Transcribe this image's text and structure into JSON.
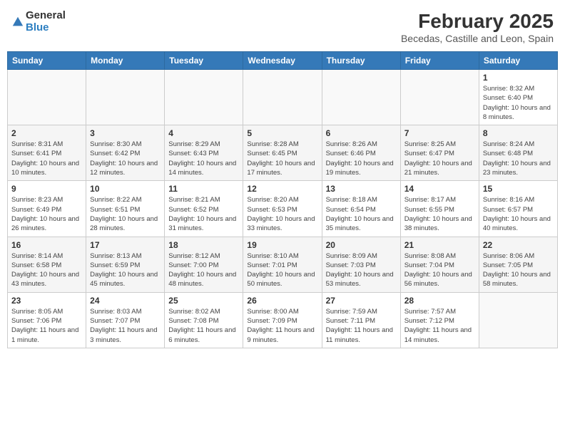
{
  "header": {
    "logo_general": "General",
    "logo_blue": "Blue",
    "title": "February 2025",
    "subtitle": "Becedas, Castille and Leon, Spain"
  },
  "days_of_week": [
    "Sunday",
    "Monday",
    "Tuesday",
    "Wednesday",
    "Thursday",
    "Friday",
    "Saturday"
  ],
  "weeks": [
    [
      {
        "day": "",
        "info": ""
      },
      {
        "day": "",
        "info": ""
      },
      {
        "day": "",
        "info": ""
      },
      {
        "day": "",
        "info": ""
      },
      {
        "day": "",
        "info": ""
      },
      {
        "day": "",
        "info": ""
      },
      {
        "day": "1",
        "info": "Sunrise: 8:32 AM\nSunset: 6:40 PM\nDaylight: 10 hours and 8 minutes."
      }
    ],
    [
      {
        "day": "2",
        "info": "Sunrise: 8:31 AM\nSunset: 6:41 PM\nDaylight: 10 hours and 10 minutes."
      },
      {
        "day": "3",
        "info": "Sunrise: 8:30 AM\nSunset: 6:42 PM\nDaylight: 10 hours and 12 minutes."
      },
      {
        "day": "4",
        "info": "Sunrise: 8:29 AM\nSunset: 6:43 PM\nDaylight: 10 hours and 14 minutes."
      },
      {
        "day": "5",
        "info": "Sunrise: 8:28 AM\nSunset: 6:45 PM\nDaylight: 10 hours and 17 minutes."
      },
      {
        "day": "6",
        "info": "Sunrise: 8:26 AM\nSunset: 6:46 PM\nDaylight: 10 hours and 19 minutes."
      },
      {
        "day": "7",
        "info": "Sunrise: 8:25 AM\nSunset: 6:47 PM\nDaylight: 10 hours and 21 minutes."
      },
      {
        "day": "8",
        "info": "Sunrise: 8:24 AM\nSunset: 6:48 PM\nDaylight: 10 hours and 23 minutes."
      }
    ],
    [
      {
        "day": "9",
        "info": "Sunrise: 8:23 AM\nSunset: 6:49 PM\nDaylight: 10 hours and 26 minutes."
      },
      {
        "day": "10",
        "info": "Sunrise: 8:22 AM\nSunset: 6:51 PM\nDaylight: 10 hours and 28 minutes."
      },
      {
        "day": "11",
        "info": "Sunrise: 8:21 AM\nSunset: 6:52 PM\nDaylight: 10 hours and 31 minutes."
      },
      {
        "day": "12",
        "info": "Sunrise: 8:20 AM\nSunset: 6:53 PM\nDaylight: 10 hours and 33 minutes."
      },
      {
        "day": "13",
        "info": "Sunrise: 8:18 AM\nSunset: 6:54 PM\nDaylight: 10 hours and 35 minutes."
      },
      {
        "day": "14",
        "info": "Sunrise: 8:17 AM\nSunset: 6:55 PM\nDaylight: 10 hours and 38 minutes."
      },
      {
        "day": "15",
        "info": "Sunrise: 8:16 AM\nSunset: 6:57 PM\nDaylight: 10 hours and 40 minutes."
      }
    ],
    [
      {
        "day": "16",
        "info": "Sunrise: 8:14 AM\nSunset: 6:58 PM\nDaylight: 10 hours and 43 minutes."
      },
      {
        "day": "17",
        "info": "Sunrise: 8:13 AM\nSunset: 6:59 PM\nDaylight: 10 hours and 45 minutes."
      },
      {
        "day": "18",
        "info": "Sunrise: 8:12 AM\nSunset: 7:00 PM\nDaylight: 10 hours and 48 minutes."
      },
      {
        "day": "19",
        "info": "Sunrise: 8:10 AM\nSunset: 7:01 PM\nDaylight: 10 hours and 50 minutes."
      },
      {
        "day": "20",
        "info": "Sunrise: 8:09 AM\nSunset: 7:03 PM\nDaylight: 10 hours and 53 minutes."
      },
      {
        "day": "21",
        "info": "Sunrise: 8:08 AM\nSunset: 7:04 PM\nDaylight: 10 hours and 56 minutes."
      },
      {
        "day": "22",
        "info": "Sunrise: 8:06 AM\nSunset: 7:05 PM\nDaylight: 10 hours and 58 minutes."
      }
    ],
    [
      {
        "day": "23",
        "info": "Sunrise: 8:05 AM\nSunset: 7:06 PM\nDaylight: 11 hours and 1 minute."
      },
      {
        "day": "24",
        "info": "Sunrise: 8:03 AM\nSunset: 7:07 PM\nDaylight: 11 hours and 3 minutes."
      },
      {
        "day": "25",
        "info": "Sunrise: 8:02 AM\nSunset: 7:08 PM\nDaylight: 11 hours and 6 minutes."
      },
      {
        "day": "26",
        "info": "Sunrise: 8:00 AM\nSunset: 7:09 PM\nDaylight: 11 hours and 9 minutes."
      },
      {
        "day": "27",
        "info": "Sunrise: 7:59 AM\nSunset: 7:11 PM\nDaylight: 11 hours and 11 minutes."
      },
      {
        "day": "28",
        "info": "Sunrise: 7:57 AM\nSunset: 7:12 PM\nDaylight: 11 hours and 14 minutes."
      },
      {
        "day": "",
        "info": ""
      }
    ]
  ]
}
